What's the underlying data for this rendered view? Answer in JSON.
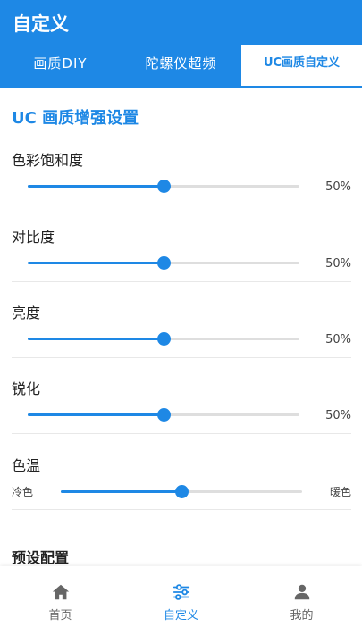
{
  "app": {
    "title": "自定义"
  },
  "tabs": [
    {
      "label": "画质DIY",
      "active": false
    },
    {
      "label": "陀螺仪超频",
      "active": false
    },
    {
      "label": "UC画质自定义",
      "active": true
    }
  ],
  "section_title": "UC 画质增强设置",
  "settings": [
    {
      "label": "色彩饱和度",
      "value": 50,
      "value_text": "50%"
    },
    {
      "label": "对比度",
      "value": 50,
      "value_text": "50%"
    },
    {
      "label": "亮度",
      "value": 50,
      "value_text": "50%"
    },
    {
      "label": "锐化",
      "value": 50,
      "value_text": "50%"
    }
  ],
  "color_temp": {
    "label": "色温",
    "min_label": "冷色",
    "max_label": "暖色",
    "value": 50
  },
  "preset_title": "预设配置",
  "bottom_nav": [
    {
      "label": "首页",
      "icon": "home-icon",
      "active": false
    },
    {
      "label": "自定义",
      "icon": "sliders-icon",
      "active": true
    },
    {
      "label": "我的",
      "icon": "person-icon",
      "active": false
    }
  ],
  "colors": {
    "accent": "#1e88e5",
    "track": "#dedede"
  }
}
